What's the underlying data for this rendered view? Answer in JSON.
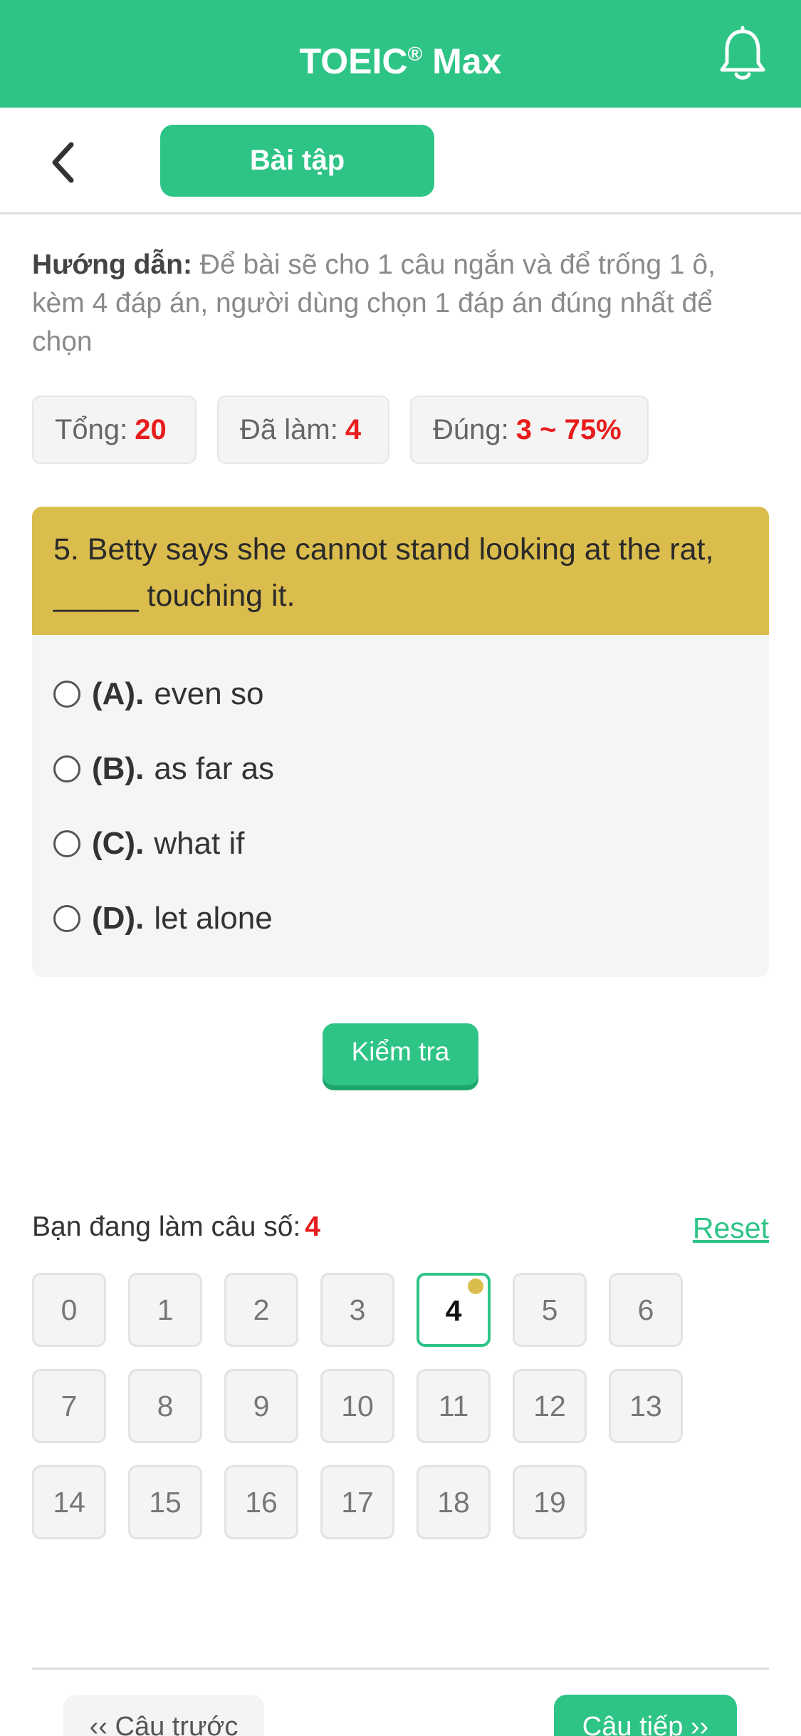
{
  "header": {
    "title": "TOEIC",
    "title_mark": "®",
    "title_suffix": " Max",
    "notification_icon": "bell-icon"
  },
  "subnav": {
    "back_icon": "chevron-left-icon",
    "tab_label": "Bài tập"
  },
  "instruction": {
    "label": "Hướng dẫn:",
    "text": " Để bài sẽ cho 1 câu ngắn và để trống 1 ô, kèm 4 đáp án, người dùng chọn 1 đáp án đúng nhất để chọn"
  },
  "stats": {
    "total_label": "Tổng:",
    "total_value": "20",
    "done_label": "Đã làm:",
    "done_value": "4",
    "correct_label": "Đúng:",
    "correct_value": "3 ~ 75%"
  },
  "question": {
    "text": "5. Betty says she cannot stand looking at the rat, _____ touching it.",
    "options": [
      {
        "key": "(A).",
        "text": "even so"
      },
      {
        "key": "(B).",
        "text": "as far as"
      },
      {
        "key": "(C).",
        "text": "what if"
      },
      {
        "key": "(D).",
        "text": "let alone"
      }
    ]
  },
  "check_label": "Kiểm tra",
  "progress": {
    "label": "Bạn đang làm câu số:",
    "current": "4",
    "reset_label": "Reset"
  },
  "question_numbers": [
    "0",
    "1",
    "2",
    "3",
    "4",
    "5",
    "6",
    "7",
    "8",
    "9",
    "10",
    "11",
    "12",
    "13",
    "14",
    "15",
    "16",
    "17",
    "18",
    "19"
  ],
  "active_question": "4",
  "footer": {
    "prev_label": "‹‹ Câu trước",
    "next_label": "Câu tiếp ››"
  },
  "colors": {
    "brand": "#2ec486",
    "question_header": "#dbbd4d",
    "highlight": "#e81c1c"
  }
}
